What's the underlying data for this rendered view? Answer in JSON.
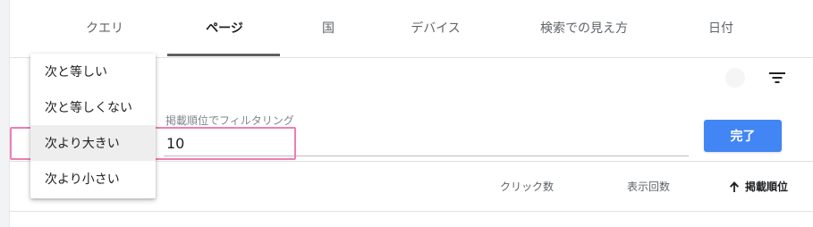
{
  "tabs": [
    {
      "label": "クエリ"
    },
    {
      "label": "ページ"
    },
    {
      "label": "国"
    },
    {
      "label": "デバイス"
    },
    {
      "label": "検索での見え方"
    },
    {
      "label": "日付"
    }
  ],
  "active_tab": "ページ",
  "filter": {
    "field_label": "掲載順位でフィルタリング",
    "value": "10",
    "done_label": "完了"
  },
  "menu": {
    "items": [
      {
        "label": "次と等しい"
      },
      {
        "label": "次と等しくない"
      },
      {
        "label": "次より大きい"
      },
      {
        "label": "次より小さい"
      }
    ],
    "selected": "次より大きい"
  },
  "table_header": {
    "clicks": "クリック数",
    "impressions": "表示回数",
    "position": "掲載順位"
  },
  "colors": {
    "accent": "#4285f4",
    "highlight": "#ec7fb4"
  },
  "icons": {
    "filter": "filter-list-icon",
    "sort": "arrow-up-icon"
  }
}
